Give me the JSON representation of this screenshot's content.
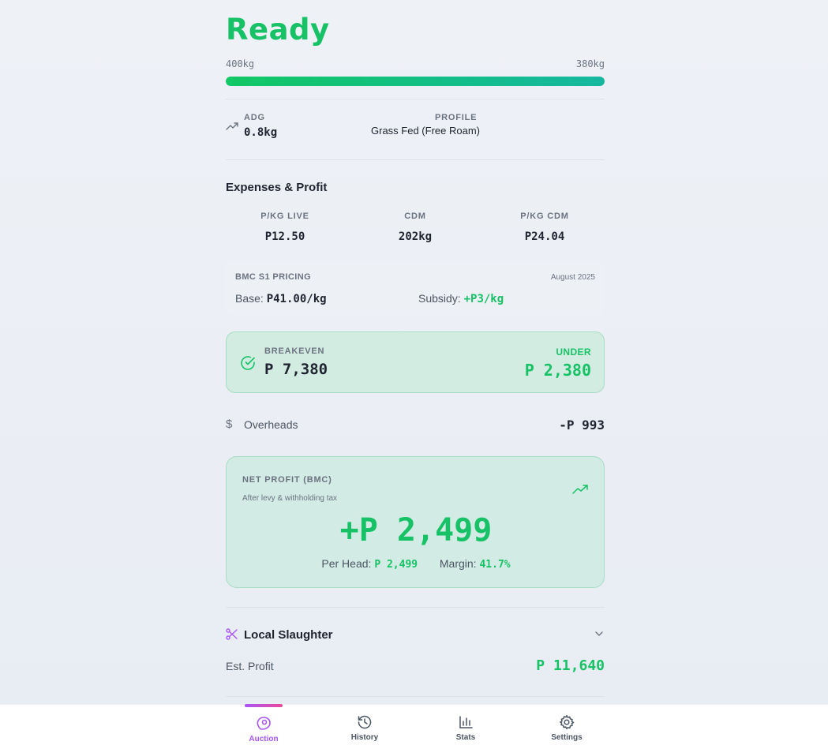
{
  "status": "Ready",
  "weights": {
    "start": "400kg",
    "target": "380kg",
    "progress_fraction": 1.0
  },
  "colors": {
    "accent_green": "#16c265",
    "accent_purple": "#a855f7",
    "progress_end": "#14b8a0"
  },
  "info": {
    "adg_label": "ADG",
    "adg_value": "0.8kg",
    "profile_label": "PROFILE",
    "profile_value": "Grass Fed (Free Roam)"
  },
  "expenses": {
    "title": "Expenses & Profit",
    "stats": [
      {
        "label": "P/KG LIVE",
        "value": "P12.50"
      },
      {
        "label": "CDM",
        "value": "202kg"
      },
      {
        "label": "P/KG CDM",
        "value": "P24.04"
      }
    ]
  },
  "pricing": {
    "label": "BMC S1 PRICING",
    "date": "August 2025",
    "base_label": "Base:",
    "base_value": "P41.00/kg",
    "subsidy_label": "Subsidy:",
    "subsidy_value": "+P3/kg"
  },
  "breakeven": {
    "label": "BREAKEVEN",
    "value": "P 7,380",
    "status_label": "UNDER",
    "status_value": "P 2,380",
    "icon": "check-circle-icon"
  },
  "overheads": {
    "label": "Overheads",
    "value": "-P 993",
    "icon": "dollar-icon"
  },
  "net_profit": {
    "label": "NET PROFIT (BMC)",
    "subtitle": "After levy & withholding tax",
    "value": "+P 2,499",
    "per_head_label": "Per Head:",
    "per_head_value": "P 2,499",
    "margin_label": "Margin:",
    "margin_value": "41.7%",
    "icon": "trending-up-icon"
  },
  "local_slaughter": {
    "title": "Local Slaughter",
    "est_label": "Est. Profit",
    "est_value": "P 11,640",
    "icon": "scissors-icon"
  },
  "tabs": [
    {
      "label": "Auction",
      "icon": "steak-icon",
      "active": true
    },
    {
      "label": "History",
      "icon": "history-icon",
      "active": false
    },
    {
      "label": "Stats",
      "icon": "bar-chart-icon",
      "active": false
    },
    {
      "label": "Settings",
      "icon": "gear-icon",
      "active": false
    }
  ]
}
